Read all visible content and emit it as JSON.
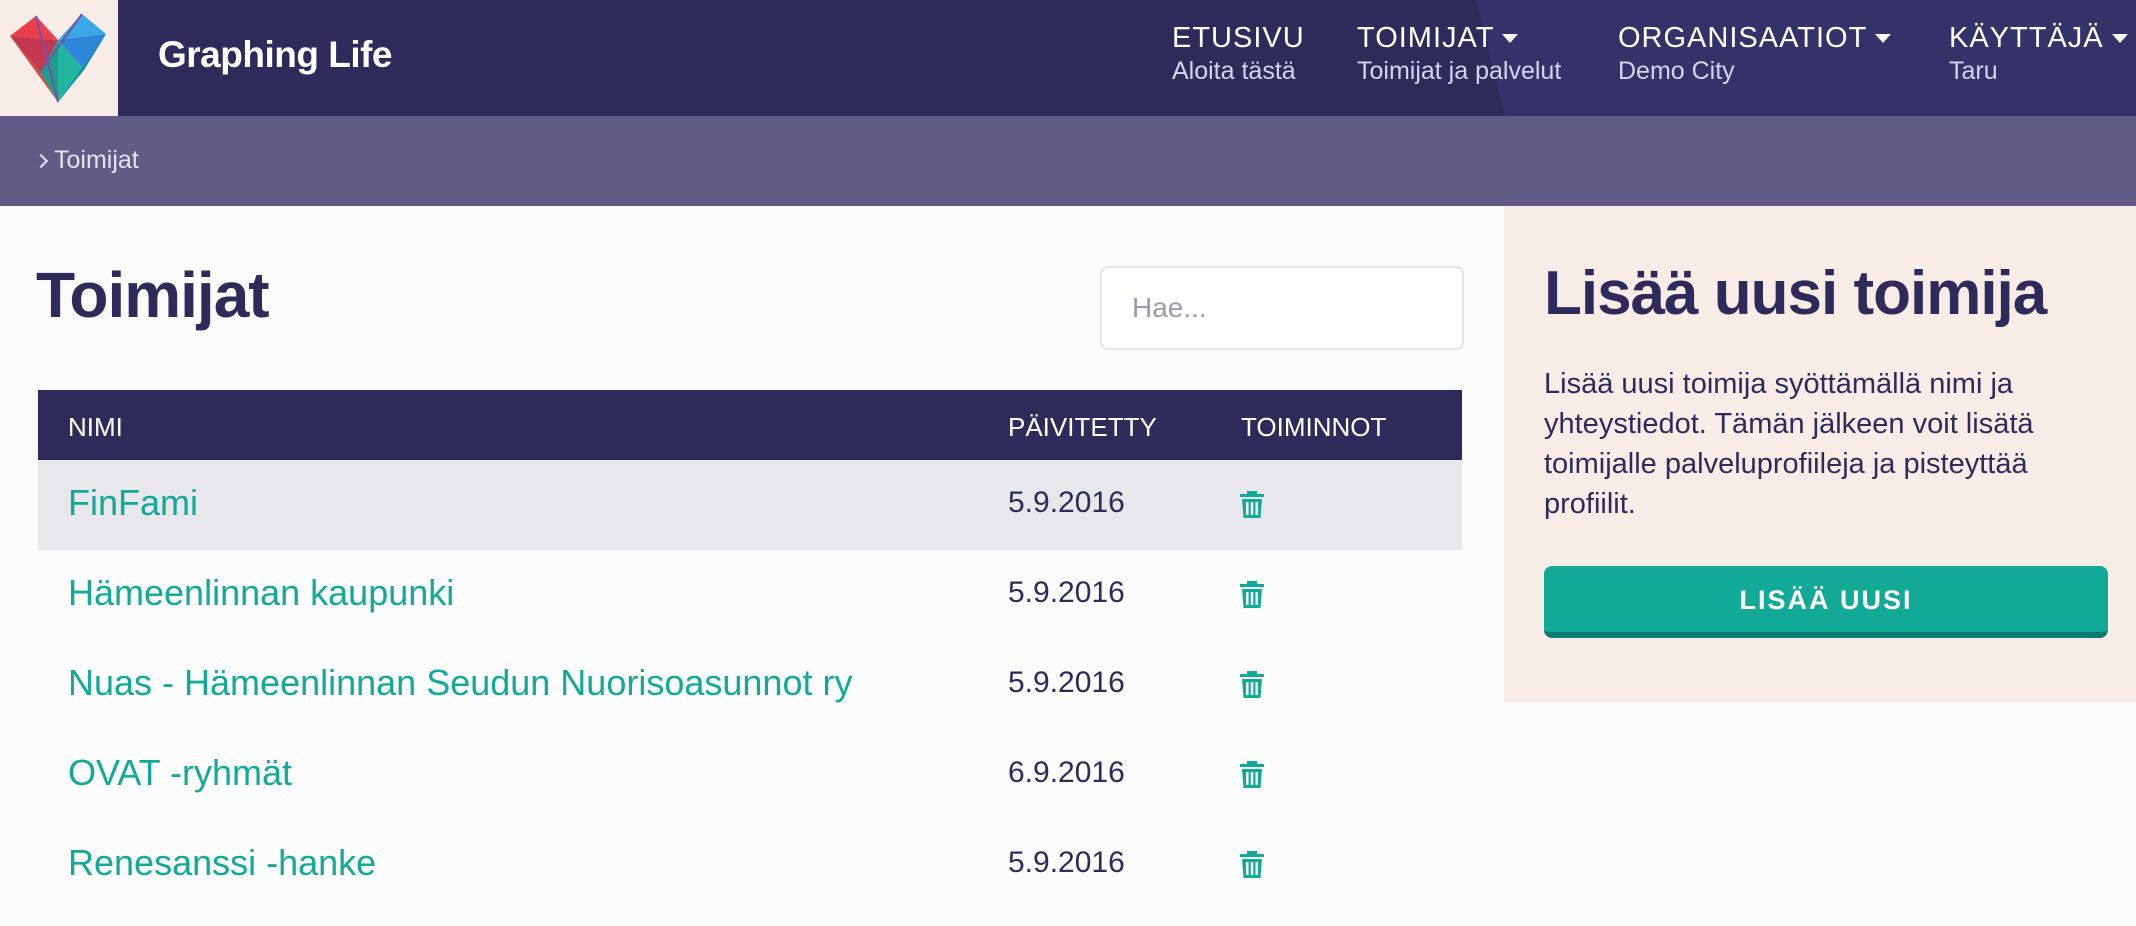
{
  "brand": {
    "name": "Graphing Life"
  },
  "nav": [
    {
      "label": "ETUSIVU",
      "sub": "Aloita tästä"
    },
    {
      "label": "TOIMIJAT",
      "sub": "Toimijat ja palvelut"
    },
    {
      "label": "ORGANISAATIOT",
      "sub": "Demo City"
    },
    {
      "label": "KÄYTTÄJÄ",
      "sub": "Taru"
    }
  ],
  "breadcrumb": {
    "current": "Toimijat"
  },
  "main": {
    "title": "Toimijat",
    "search_placeholder": "Hae...",
    "table": {
      "headers": [
        "NIMI",
        "PÄIVITETTY",
        "TOIMINNOT"
      ],
      "rows": [
        {
          "name": "FinFami",
          "date": "5.9.2016"
        },
        {
          "name": "Hämeenlinnan kaupunki",
          "date": "5.9.2016"
        },
        {
          "name": "Nuas - Hämeenlinnan Seudun Nuorisoasunnot ry",
          "date": "5.9.2016"
        },
        {
          "name": "OVAT -ryhmät",
          "date": "6.9.2016"
        },
        {
          "name": "Renesanssi -hanke",
          "date": "5.9.2016"
        }
      ]
    }
  },
  "sidebar": {
    "title": "Lisää uusi toimija",
    "description": "Lisää uusi toimija syöttämällä nimi ja yhteystiedot. Tämän jälkeen voit lisätä toimijalle palveluprofiileja ja pisteyttää profiilit.",
    "button_label": "LISÄÄ UUSI"
  },
  "colors": {
    "header": "#2e2b5b",
    "breadcrumb": "#605c85",
    "accent": "#12a996",
    "sidebar_bg": "#f8ece6"
  },
  "icons": {
    "delete": "trash-icon",
    "logo": "polygon-heart-logo"
  }
}
